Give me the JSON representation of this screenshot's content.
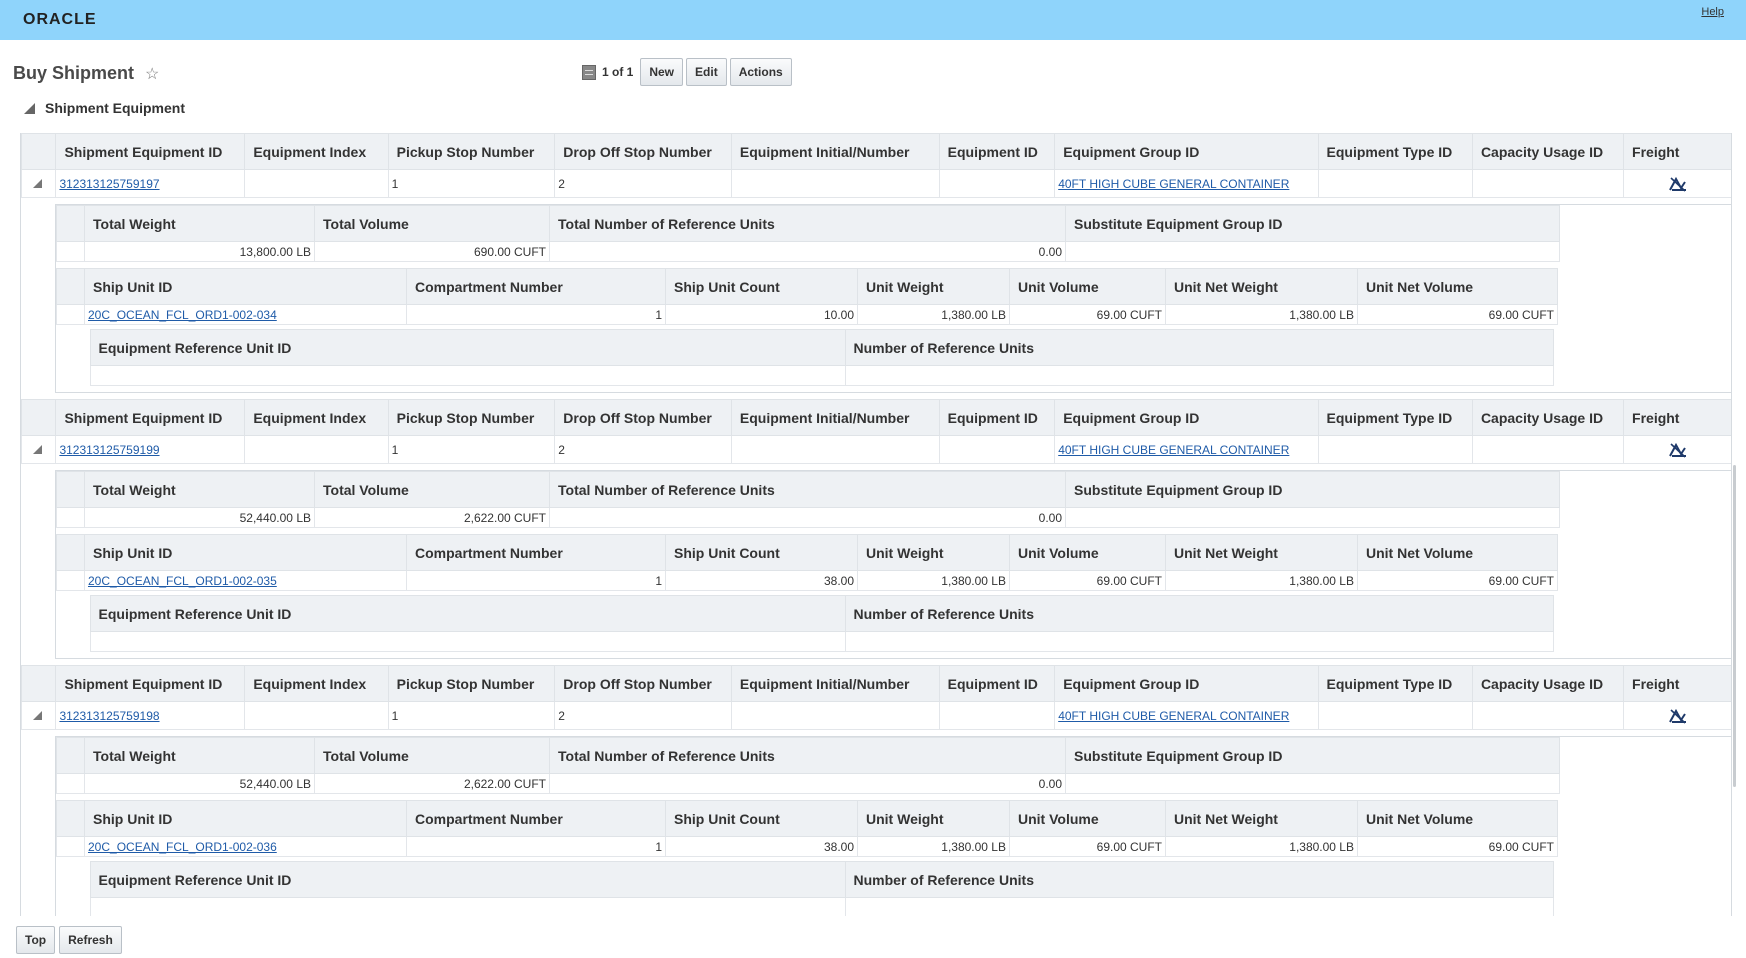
{
  "header": {
    "logo": "ORACLE",
    "help": "Help"
  },
  "page": {
    "title": "Buy Shipment"
  },
  "toolbar": {
    "count": "1 of 1",
    "new": "New",
    "edit": "Edit",
    "actions": "Actions"
  },
  "section": {
    "title": "Shipment Equipment"
  },
  "columns": {
    "main": [
      "Shipment Equipment ID",
      "Equipment Index",
      "Pickup Stop Number",
      "Drop Off Stop Number",
      "Equipment Initial/Number",
      "Equipment ID",
      "Equipment Group ID",
      "Equipment Type ID",
      "Capacity Usage ID",
      "Freight"
    ],
    "totals": [
      "Total Weight",
      "Total Volume",
      "Total Number of Reference Units",
      "Substitute Equipment Group ID"
    ],
    "shipunit": [
      "Ship Unit ID",
      "Compartment Number",
      "Ship Unit Count",
      "Unit Weight",
      "Unit Volume",
      "Unit Net Weight",
      "Unit Net Volume"
    ],
    "reference": [
      "Equipment Reference Unit ID",
      "Number of Reference Units"
    ]
  },
  "equipment": [
    {
      "id": "312313125759197",
      "index": "",
      "pickup": "1",
      "dropoff": "2",
      "initial": "",
      "equipment_id": "",
      "group": "40FT HIGH CUBE GENERAL CONTAINER",
      "type": "",
      "capacity": "",
      "total_weight": "13,800.00 LB",
      "total_volume": "690.00 CUFT",
      "total_ref_units": "0.00",
      "substitute": "",
      "ship_unit": {
        "id": "20C_OCEAN_FCL_ORD1-002-034",
        "compartment": "1",
        "count": "10.00",
        "unit_weight": "1,380.00 LB",
        "unit_volume": "69.00 CUFT",
        "net_weight": "1,380.00 LB",
        "net_volume": "69.00 CUFT"
      }
    },
    {
      "id": "312313125759199",
      "index": "",
      "pickup": "1",
      "dropoff": "2",
      "initial": "",
      "equipment_id": "",
      "group": "40FT HIGH CUBE GENERAL CONTAINER",
      "type": "",
      "capacity": "",
      "total_weight": "52,440.00 LB",
      "total_volume": "2,622.00 CUFT",
      "total_ref_units": "0.00",
      "substitute": "",
      "ship_unit": {
        "id": "20C_OCEAN_FCL_ORD1-002-035",
        "compartment": "1",
        "count": "38.00",
        "unit_weight": "1,380.00 LB",
        "unit_volume": "69.00 CUFT",
        "net_weight": "1,380.00 LB",
        "net_volume": "69.00 CUFT"
      }
    },
    {
      "id": "312313125759198",
      "index": "",
      "pickup": "1",
      "dropoff": "2",
      "initial": "",
      "equipment_id": "",
      "group": "40FT HIGH CUBE GENERAL CONTAINER",
      "type": "",
      "capacity": "",
      "total_weight": "52,440.00 LB",
      "total_volume": "2,622.00 CUFT",
      "total_ref_units": "0.00",
      "substitute": "",
      "ship_unit": {
        "id": "20C_OCEAN_FCL_ORD1-002-036",
        "compartment": "1",
        "count": "38.00",
        "unit_weight": "1,380.00 LB",
        "unit_volume": "69.00 CUFT",
        "net_weight": "1,380.00 LB",
        "net_volume": "69.00 CUFT"
      }
    }
  ],
  "footer": {
    "top": "Top",
    "refresh": "Refresh"
  },
  "colors": {
    "topbar": "#8fd4fb",
    "link": "#1f5ba8",
    "header_bg": "#eef1f4"
  }
}
